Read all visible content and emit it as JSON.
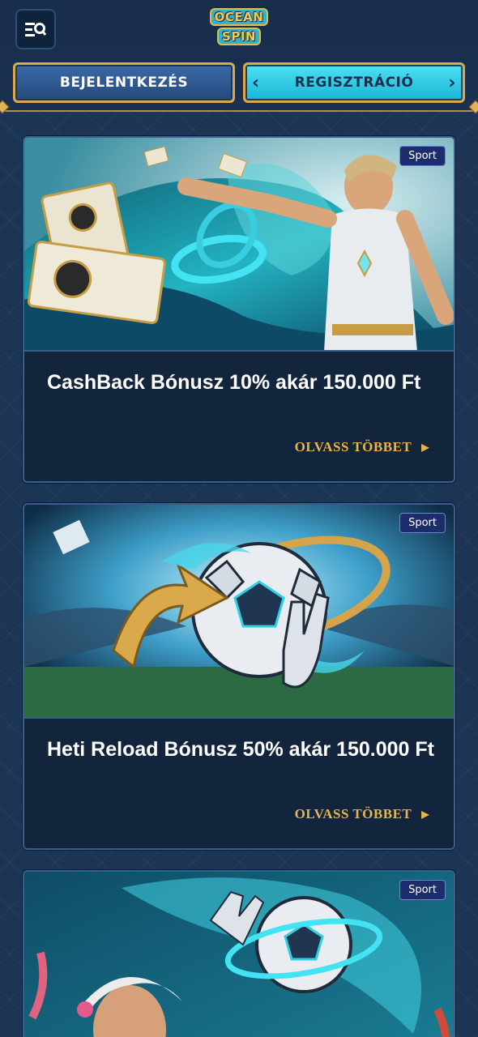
{
  "header": {
    "logo_line1": "OCEAN",
    "logo_line2": "SPIN",
    "login_label": "BEJELENTKEZÉS",
    "register_label": "REGISZTRÁCIÓ"
  },
  "promotions": [
    {
      "tag": "Sport",
      "title": "CashBack Bónusz 10% akár 150.000 Ft",
      "link": "OLVASS TÖBBET"
    },
    {
      "tag": "Sport",
      "title": "Heti Reload Bónusz 50% akár 150.000 Ft",
      "link": "OLVASS TÖBBET"
    },
    {
      "tag": "Sport"
    }
  ]
}
